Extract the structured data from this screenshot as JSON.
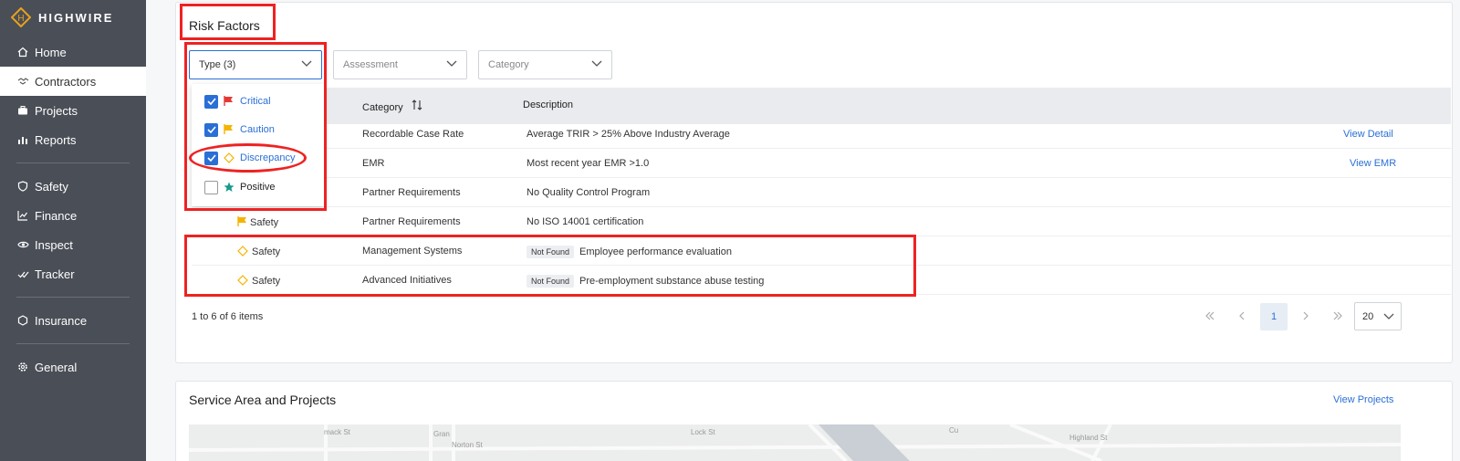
{
  "app": {
    "brand": "HIGHWIRE",
    "brand_letter": "H",
    "accent": "#e8a21b"
  },
  "sidebar": {
    "items": [
      {
        "label": "Home",
        "icon": "home-icon"
      },
      {
        "label": "Contractors",
        "icon": "handshake-icon",
        "active": true
      },
      {
        "label": "Projects",
        "icon": "briefcase-icon"
      },
      {
        "label": "Reports",
        "icon": "bar-chart-icon"
      },
      {
        "label": "Safety",
        "icon": "shield-icon"
      },
      {
        "label": "Finance",
        "icon": "line-chart-icon"
      },
      {
        "label": "Inspect",
        "icon": "eye-icon"
      },
      {
        "label": "Tracker",
        "icon": "double-check-icon"
      },
      {
        "label": "Insurance",
        "icon": "hexagon-icon"
      },
      {
        "label": "General",
        "icon": "gear-icon"
      }
    ]
  },
  "risk": {
    "title": "Risk Factors",
    "filters": {
      "type": "Type (3)",
      "assessment": "Assessment",
      "category": "Category"
    },
    "type_options": [
      {
        "label": "Critical",
        "checked": true,
        "icon": "red-flag-icon",
        "color": "#e53935"
      },
      {
        "label": "Caution",
        "checked": true,
        "icon": "yellow-flag-icon",
        "color": "#f4b400"
      },
      {
        "label": "Discrepancy",
        "checked": true,
        "icon": "diamond-icon",
        "color": "#f4b400"
      },
      {
        "label": "Positive",
        "checked": false,
        "icon": "star-icon",
        "color": "#1a9a8c"
      }
    ],
    "columns": {
      "category": "Category",
      "description": "Description"
    },
    "rows": [
      {
        "category": "Recordable Case Rate",
        "description": "Average TRIR > 25% Above Industry Average",
        "action": "View Detail"
      },
      {
        "category": "EMR",
        "description": "Most recent year EMR >1.0",
        "action": "View EMR"
      },
      {
        "category": "Partner Requirements",
        "description": "No Quality Control Program",
        "action": ""
      },
      {
        "type_label": "Safety",
        "type_icon": "yellow-flag-icon",
        "category": "Partner Requirements",
        "description": "No ISO 14001 certification",
        "action": ""
      },
      {
        "type_label": "Safety",
        "type_icon": "diamond-icon",
        "category": "Management Systems",
        "badge": "Not Found",
        "description": "Employee performance evaluation",
        "action": ""
      },
      {
        "type_label": "Safety",
        "type_icon": "diamond-icon",
        "category": "Advanced Initiatives",
        "badge": "Not Found",
        "description": "Pre-employment substance abuse testing",
        "action": ""
      }
    ],
    "footer": "1 to 6 of 6 items",
    "pagination": {
      "current": "1",
      "page_size": "20"
    }
  },
  "service": {
    "title": "Service Area and Projects",
    "link": "View Projects",
    "map_labels": [
      "Lock St",
      "mack St",
      "Gran",
      "Norton St",
      "Highland St",
      "Cu"
    ]
  }
}
